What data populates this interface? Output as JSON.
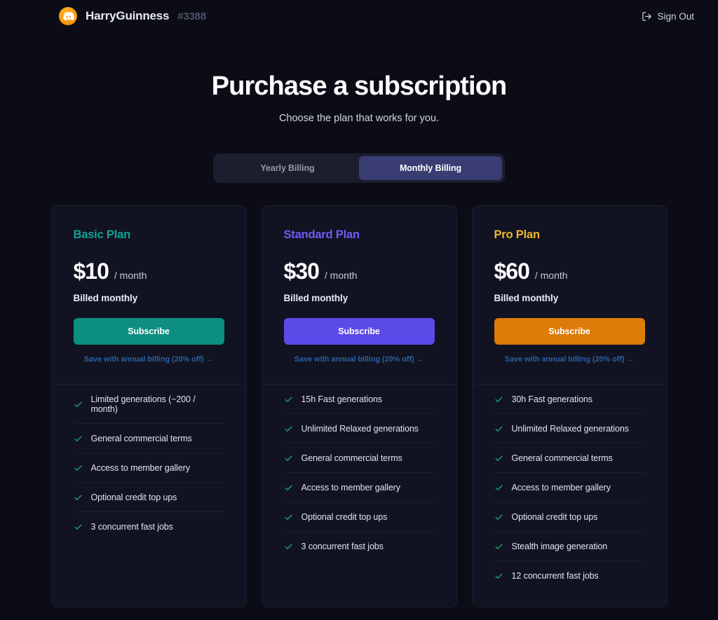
{
  "header": {
    "avatar_icon": "discord-logo-icon",
    "username": "HarryGuinness",
    "discriminator": "#3388",
    "signout_label": "Sign Out",
    "signout_icon": "logout-icon"
  },
  "hero": {
    "title": "Purchase a subscription",
    "subtitle": "Choose the plan that works for you."
  },
  "billing_toggle": {
    "options": [
      {
        "label": "Yearly Billing",
        "active": false
      },
      {
        "label": "Monthly Billing",
        "active": true
      }
    ]
  },
  "colors": {
    "page_bg": "#0b0c15",
    "card_bg": "#111322",
    "card_border": "#1a1d2e",
    "toggle_track": "#1b1e2c",
    "toggle_active": "#393d72",
    "link": "#2c5f9f",
    "check": "#1f9f63",
    "basic_accent": "#10a293",
    "standard_accent": "#6455f0",
    "pro_accent": "#f0b429",
    "pro_button": "#dc7c09",
    "basic_button": "#0c8f82",
    "standard_button": "#5b4ae8"
  },
  "plans": [
    {
      "name": "Basic Plan",
      "name_color": "#10a293",
      "price": "$10",
      "period": "/ month",
      "billed": "Billed monthly",
      "subscribe_label": "Subscribe",
      "button_color": "#0c8f82",
      "annual_link": "Save with annual billing (20% off) →",
      "features": [
        "Limited generations (~200 / month)",
        "General commercial terms",
        "Access to member gallery",
        "Optional credit top ups",
        "3 concurrent fast jobs"
      ]
    },
    {
      "name": "Standard Plan",
      "name_color": "#6d5ef5",
      "price": "$30",
      "period": "/ month",
      "billed": "Billed monthly",
      "subscribe_label": "Subscribe",
      "button_color": "#5b4ae8",
      "annual_link": "Save with annual billing (20% off) →",
      "features": [
        "15h Fast generations",
        "Unlimited Relaxed generations",
        "General commercial terms",
        "Access to member gallery",
        "Optional credit top ups",
        "3 concurrent fast jobs"
      ]
    },
    {
      "name": "Pro Plan",
      "name_color": "#f0b429",
      "price": "$60",
      "period": "/ month",
      "billed": "Billed monthly",
      "subscribe_label": "Subscribe",
      "button_color": "#dc7c09",
      "annual_link": "Save with annual billing (20% off) →",
      "features": [
        "30h Fast generations",
        "Unlimited Relaxed generations",
        "General commercial terms",
        "Access to member gallery",
        "Optional credit top ups",
        "Stealth image generation",
        "12 concurrent fast jobs"
      ]
    }
  ]
}
